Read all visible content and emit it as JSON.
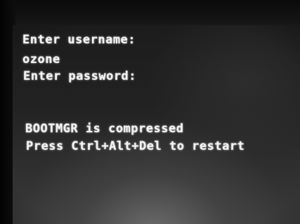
{
  "console": {
    "lines": [
      "Enter username:",
      "ozone",
      "Enter password:",
      "BOOTMGR is compressed",
      "Press Ctrl+Alt+Del to restart"
    ]
  }
}
